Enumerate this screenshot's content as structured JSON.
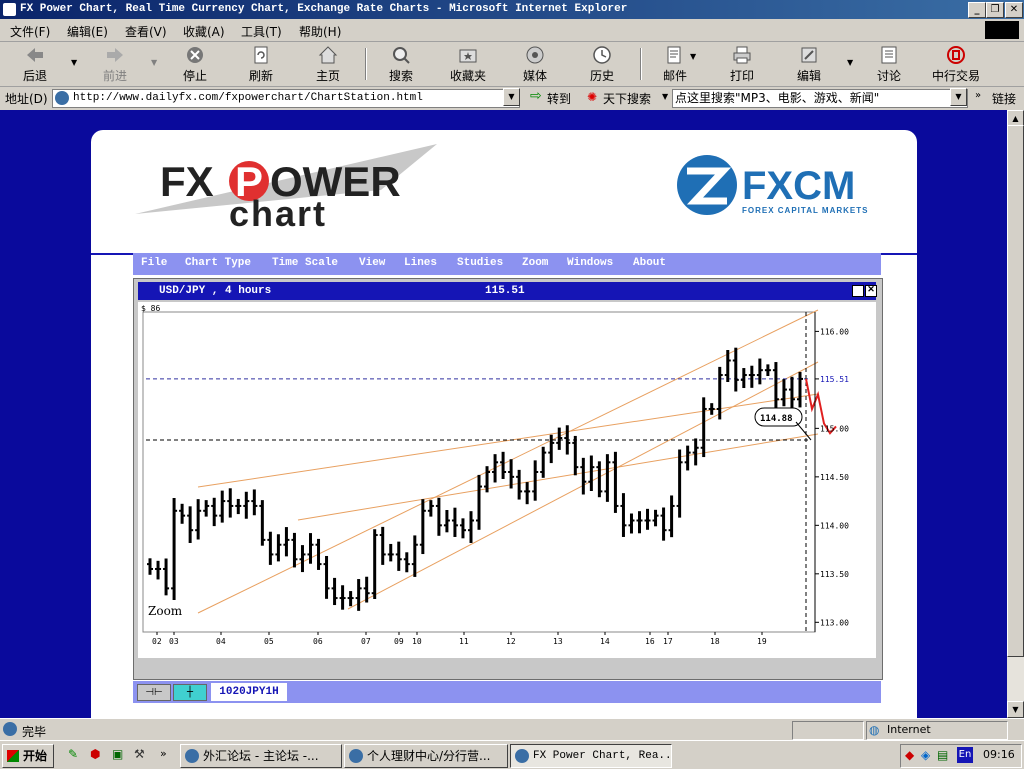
{
  "window": {
    "title": "FX Power Chart, Real Time Currency Chart, Exchange Rate Charts - Microsoft Internet Explorer",
    "min": "_",
    "max": "❐",
    "close": "✕"
  },
  "menubar": [
    "文件(F)",
    "编辑(E)",
    "查看(V)",
    "收藏(A)",
    "工具(T)",
    "帮助(H)"
  ],
  "toolbar": {
    "back": "后退",
    "forward": "前进",
    "stop": "停止",
    "refresh": "刷新",
    "home": "主页",
    "search": "搜索",
    "favorites": "收藏夹",
    "media": "媒体",
    "history": "历史",
    "mail": "邮件",
    "print": "打印",
    "edit": "编辑",
    "discuss": "讨论",
    "bank": "中行交易"
  },
  "address": {
    "label": "地址(D)",
    "url": "http://www.dailyfx.com/fxpowerchart/ChartStation.html",
    "go": "转到",
    "search_label": "天下搜索",
    "search_placeholder": "点这里搜索\"MP3、电影、游戏、新闻\"",
    "links": "链接"
  },
  "logo": {
    "fx": "FX",
    "p": "P",
    "ower": "OWER",
    "chart": "chart",
    "fxcm": "FXCM",
    "fxcm_sub": "FOREX CAPITAL MARKETS"
  },
  "app_menu": [
    "File",
    "Chart Type",
    "Time Scale",
    "View",
    "Lines",
    "Studies",
    "Zoom",
    "Windows",
    "About"
  ],
  "chart_window": {
    "symbol": "USD/JPY , 4 hours",
    "price": "115.51",
    "dollar_label": "$ 86",
    "zoom_label": "Zoom",
    "callout": "114.88",
    "tab_label": "1020JPY1H"
  },
  "chart_data": {
    "type": "ohlc",
    "title": "USD/JPY , 4 hours",
    "ylim": [
      112.9,
      116.2
    ],
    "yticks": [
      113.0,
      113.5,
      114.0,
      114.5,
      115.0,
      115.51,
      116.0
    ],
    "xticks": [
      "02",
      "03",
      "04",
      "05",
      "06",
      "07",
      "09",
      "10",
      "11",
      "12",
      "13",
      "14",
      "16",
      "17",
      "18",
      "19"
    ],
    "current_price": 115.51,
    "reference_price": 114.88,
    "closes": [
      113.55,
      113.55,
      113.35,
      114.15,
      114.1,
      113.95,
      114.15,
      114.2,
      114.1,
      114.25,
      114.2,
      114.2,
      114.25,
      114.2,
      113.85,
      113.7,
      113.8,
      113.85,
      113.65,
      113.7,
      113.8,
      113.6,
      113.35,
      113.25,
      113.25,
      113.25,
      113.35,
      113.3,
      113.9,
      113.7,
      113.7,
      113.65,
      113.6,
      113.8,
      114.15,
      114.2,
      114.0,
      114.05,
      114.0,
      113.95,
      114.05,
      114.4,
      114.55,
      114.65,
      114.55,
      114.5,
      114.35,
      114.35,
      114.55,
      114.75,
      114.85,
      114.9,
      114.85,
      114.6,
      114.45,
      114.6,
      114.35,
      114.65,
      114.2,
      114.0,
      114.05,
      114.05,
      114.05,
      114.1,
      113.95,
      114.2,
      114.65,
      114.75,
      114.8,
      115.2,
      115.2,
      115.55,
      115.7,
      115.5,
      115.55,
      115.55,
      115.6,
      115.6,
      115.3,
      115.4,
      115.3,
      115.51
    ],
    "projection": [
      115.51,
      115.2,
      115.35,
      115.05,
      114.95,
      115.02
    ]
  },
  "status": {
    "done": "完毕",
    "zone": "Internet"
  },
  "taskbar": {
    "start": "开始",
    "task1": "外汇论坛 - 主论坛 -...",
    "task2": "个人理财中心/分行营...",
    "task3": "FX Power Chart, Rea...",
    "ime": "En",
    "clock": "09:16"
  }
}
